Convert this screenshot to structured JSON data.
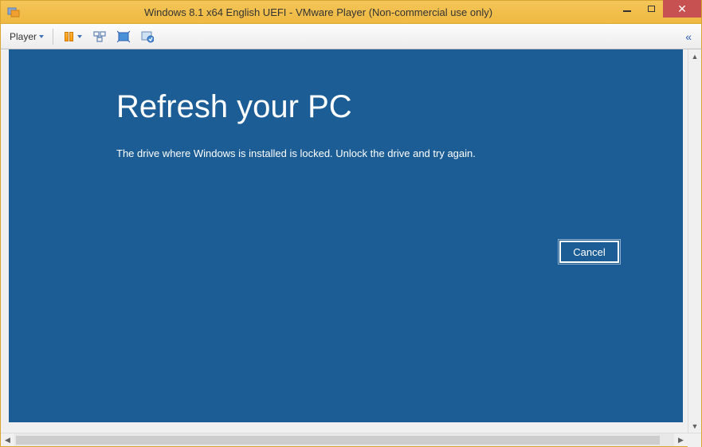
{
  "window": {
    "title": "Windows 8.1 x64 English UEFI - VMware Player (Non-commercial use only)"
  },
  "titlebar_controls": {
    "minimize": "minimize",
    "maximize": "maximize",
    "close": "close"
  },
  "toolbar": {
    "player_label": "Player",
    "collapse_label": "«"
  },
  "vm": {
    "heading": "Refresh your PC",
    "message": "The drive where Windows is installed is locked. Unlock the drive and try again.",
    "cancel_label": "Cancel"
  }
}
